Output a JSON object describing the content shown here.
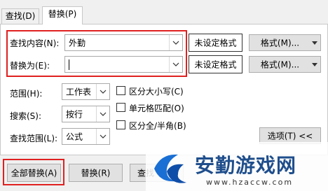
{
  "tabs": {
    "find": "查找(D)",
    "replace": "替换(P)"
  },
  "find": {
    "label": "查找内容(N):",
    "value": "外勤",
    "format_status": "未设定格式",
    "format_button": "格式(M)..."
  },
  "replace": {
    "label": "替换为(E):",
    "value": "",
    "format_status": "未设定格式",
    "format_button": "格式(M)..."
  },
  "options": {
    "scope_label": "范围(H):",
    "scope_value": "工作表",
    "search_label": "搜索(S):",
    "search_value": "按行",
    "lookin_label": "查找范围(L):",
    "lookin_value": "公式",
    "match_case": "区分大小写(C)",
    "match_cell": "单元格匹配(O)",
    "match_width": "区分全/半角(B)",
    "options_button": "选项(T) <<"
  },
  "buttons": {
    "replace_all": "全部替换(A)",
    "replace": "替换(R)",
    "find_all": "查找"
  },
  "watermark": {
    "site": "安勤游戏网",
    "url": "www.hzaccw.com"
  },
  "colors": {
    "highlight": "#e02020",
    "watermark_blue": "#1a6fd4",
    "watermark_text": "#1f4e8c"
  }
}
